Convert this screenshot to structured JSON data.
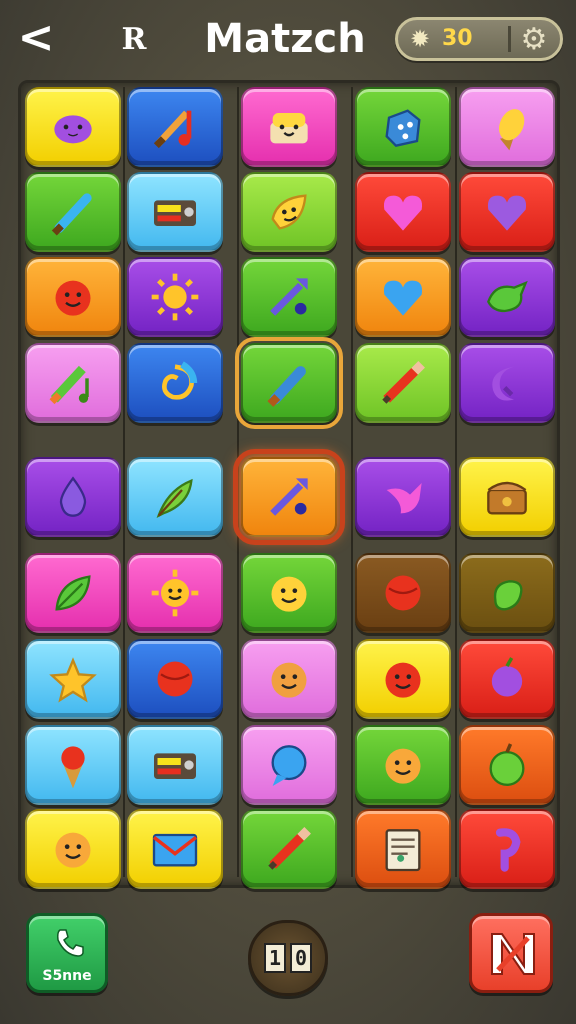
{
  "header": {
    "back_label": "<",
    "logo_letter": "R",
    "title": "Matzch",
    "coins": "30"
  },
  "board": {
    "rows": [
      [
        {
          "icon": "purple-blob-icon",
          "color": "yellow"
        },
        {
          "icon": "brush-note-icon",
          "color": "blue"
        },
        {
          "icon": "smiling-cake-icon",
          "color": "pink"
        },
        {
          "icon": "blue-cube-icon",
          "color": "green"
        },
        {
          "icon": "ice-cream-icon",
          "color": "lilac"
        }
      ],
      [
        {
          "icon": "paint-brush-icon",
          "color": "green"
        },
        {
          "icon": "radio-icon",
          "color": "sky"
        },
        {
          "icon": "smiling-leaf-icon",
          "color": "lime"
        },
        {
          "icon": "pink-heart-icon",
          "color": "red"
        },
        {
          "icon": "purple-heart-icon",
          "color": "red"
        }
      ],
      [
        {
          "icon": "red-face-icon",
          "color": "orange"
        },
        {
          "icon": "sun-icon",
          "color": "purple"
        },
        {
          "icon": "arrow-note-icon",
          "color": "green"
        },
        {
          "icon": "blue-heart-icon",
          "color": "orange"
        },
        {
          "icon": "green-bird-icon",
          "color": "purple"
        }
      ],
      [
        {
          "icon": "green-note-icon",
          "color": "lilac"
        },
        {
          "icon": "swirl-icon",
          "color": "blue"
        },
        {
          "icon": "brush-icon",
          "color": "green",
          "state": "selected"
        },
        {
          "icon": "pencil-icon",
          "color": "lime"
        },
        {
          "icon": "purple-moon-icon",
          "color": "purple"
        }
      ],
      [
        {
          "icon": "purple-drop-icon",
          "color": "purple"
        },
        {
          "icon": "feather-icon",
          "color": "sky"
        },
        {
          "icon": "arrow-note-icon",
          "color": "orange",
          "state": "active"
        },
        {
          "icon": "pink-bird-icon",
          "color": "purple"
        },
        {
          "icon": "treasure-chest-icon",
          "color": "yellow"
        }
      ],
      [
        {
          "icon": "green-leaf-icon",
          "color": "pink"
        },
        {
          "icon": "smiling-sun-icon",
          "color": "pink"
        },
        {
          "icon": "smiling-face-icon",
          "color": "green"
        },
        {
          "icon": "red-ball-icon",
          "color": "brown"
        },
        {
          "icon": "green-bean-icon",
          "color": "olive"
        }
      ],
      [
        {
          "icon": "yellow-star-icon",
          "color": "sky"
        },
        {
          "icon": "red-ball-icon",
          "color": "blue"
        },
        {
          "icon": "cookie-face-icon",
          "color": "lilac"
        },
        {
          "icon": "red-face-icon",
          "color": "yellow"
        },
        {
          "icon": "purple-fruit-icon",
          "color": "red"
        }
      ],
      [
        {
          "icon": "ice-cream-cone-icon",
          "color": "sky"
        },
        {
          "icon": "radio-icon",
          "color": "sky"
        },
        {
          "icon": "speech-bubble-icon",
          "color": "lilac"
        },
        {
          "icon": "orange-face-icon",
          "color": "green"
        },
        {
          "icon": "green-apple-icon",
          "color": "rust"
        }
      ],
      [
        {
          "icon": "orange-face-icon",
          "color": "yellow"
        },
        {
          "icon": "envelope-icon",
          "color": "yellow"
        },
        {
          "icon": "pencil-icon",
          "color": "green"
        },
        {
          "icon": "document-icon",
          "color": "rust"
        },
        {
          "icon": "purple-note-icon",
          "color": "red"
        }
      ]
    ]
  },
  "footer": {
    "left_label": "S5nne",
    "counter_digits": [
      "1",
      "0"
    ]
  },
  "colors": {
    "yellow": "#f7e21c",
    "blue": "#2b66d8",
    "pink": "#f24cc0",
    "green": "#52bd2a",
    "lilac": "#eb86e6",
    "sky": "#66cef7",
    "lime": "#8ad836",
    "red": "#ea3426",
    "orange": "#f89c22",
    "purple": "#8c38d6",
    "brown": "#7a4c1a",
    "olive": "#7c5e16",
    "rust": "#ee6420"
  }
}
